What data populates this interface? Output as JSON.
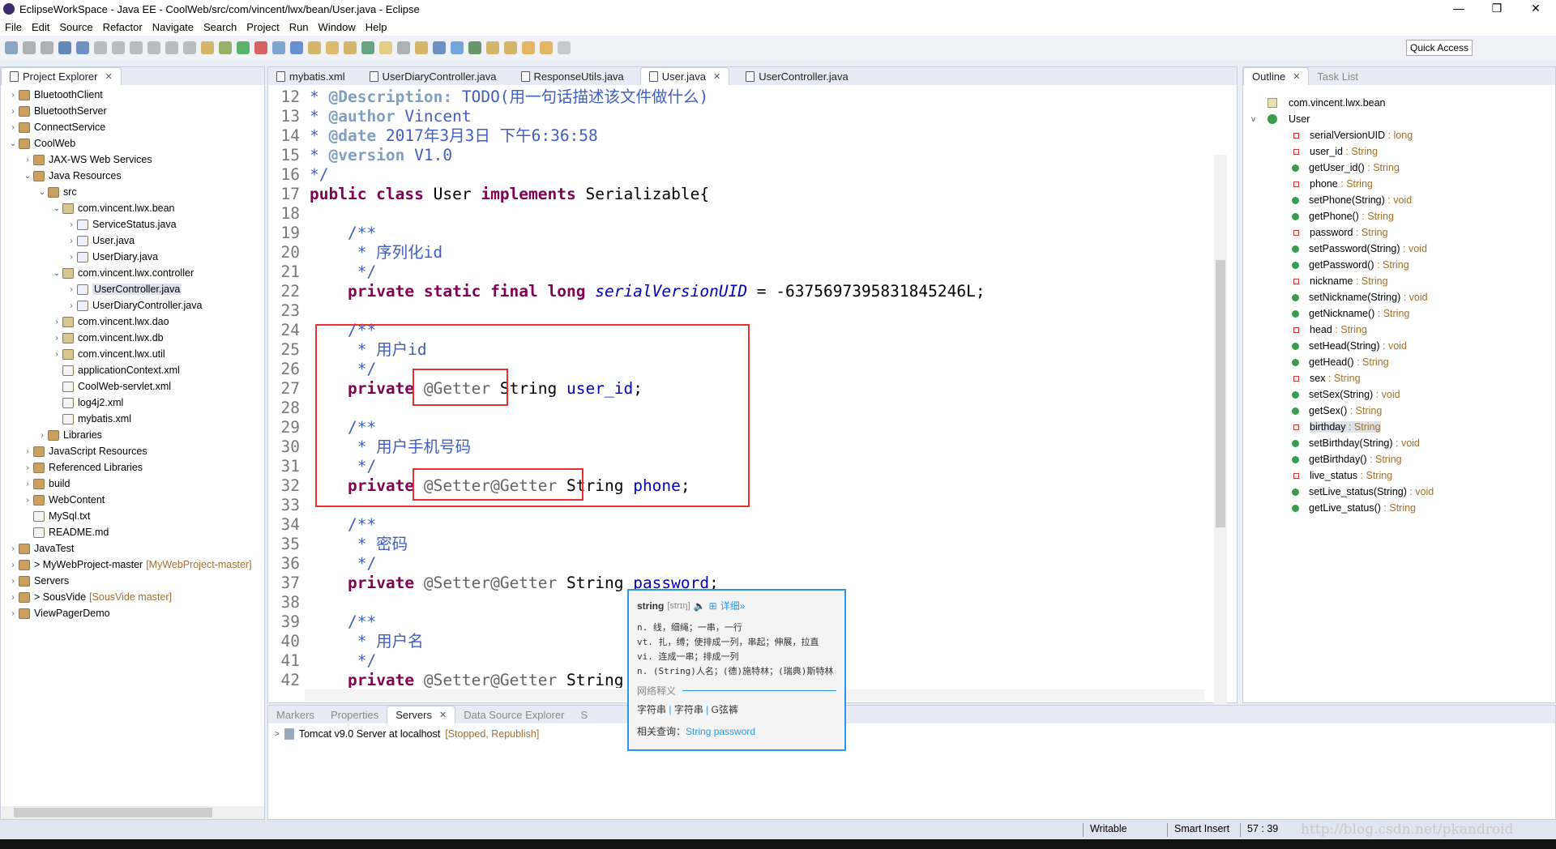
{
  "window": {
    "title": "EclipseWorkSpace - Java EE - CoolWeb/src/com/vincent/lwx/bean/User.java - Eclipse"
  },
  "menu": [
    "File",
    "Edit",
    "Source",
    "Refactor",
    "Navigate",
    "Search",
    "Project",
    "Run",
    "Window",
    "Help"
  ],
  "toolbar": {
    "quick_access": "Quick Access"
  },
  "project_explorer": {
    "title": "Project Explorer",
    "items": [
      {
        "label": "BluetoothClient",
        "level": 0,
        "exp": ">"
      },
      {
        "label": "BluetoothServer",
        "level": 0,
        "exp": ">"
      },
      {
        "label": "ConnectService",
        "level": 0,
        "exp": ">"
      },
      {
        "label": "CoolWeb",
        "level": 0,
        "exp": "v"
      },
      {
        "label": "JAX-WS Web Services",
        "level": 1,
        "exp": ">"
      },
      {
        "label": "Java Resources",
        "level": 1,
        "exp": "v"
      },
      {
        "label": "src",
        "level": 2,
        "exp": "v"
      },
      {
        "label": "com.vincent.lwx.bean",
        "level": 3,
        "exp": "v"
      },
      {
        "label": "ServiceStatus.java",
        "level": 4,
        "exp": ">"
      },
      {
        "label": "User.java",
        "level": 4,
        "exp": ">"
      },
      {
        "label": "UserDiary.java",
        "level": 4,
        "exp": ">"
      },
      {
        "label": "com.vincent.lwx.controller",
        "level": 3,
        "exp": "v"
      },
      {
        "label": "UserController.java",
        "level": 4,
        "exp": ">",
        "selected": true
      },
      {
        "label": "UserDiaryController.java",
        "level": 4,
        "exp": ">"
      },
      {
        "label": "com.vincent.lwx.dao",
        "level": 3,
        "exp": ">"
      },
      {
        "label": "com.vincent.lwx.db",
        "level": 3,
        "exp": ">"
      },
      {
        "label": "com.vincent.lwx.util",
        "level": 3,
        "exp": ">"
      },
      {
        "label": "applicationContext.xml",
        "level": 3,
        "exp": ""
      },
      {
        "label": "CoolWeb-servlet.xml",
        "level": 3,
        "exp": ""
      },
      {
        "label": "log4j2.xml",
        "level": 3,
        "exp": ""
      },
      {
        "label": "mybatis.xml",
        "level": 3,
        "exp": ""
      },
      {
        "label": "Libraries",
        "level": 2,
        "exp": ">"
      },
      {
        "label": "JavaScript Resources",
        "level": 1,
        "exp": ">"
      },
      {
        "label": "Referenced Libraries",
        "level": 1,
        "exp": ">"
      },
      {
        "label": "build",
        "level": 1,
        "exp": ">"
      },
      {
        "label": "WebContent",
        "level": 1,
        "exp": ">"
      },
      {
        "label": "MySql.txt",
        "level": 1,
        "exp": ""
      },
      {
        "label": "README.md",
        "level": 1,
        "exp": ""
      },
      {
        "label": "JavaTest",
        "level": 0,
        "exp": ">"
      },
      {
        "label": "> MyWebProject-master",
        "level": 0,
        "exp": ">",
        "deco": "[MyWebProject-master]"
      },
      {
        "label": "Servers",
        "level": 0,
        "exp": ">"
      },
      {
        "label": "> SousVide",
        "level": 0,
        "exp": ">",
        "deco": "[SousVide master]"
      },
      {
        "label": "ViewPagerDemo",
        "level": 0,
        "exp": ">"
      }
    ]
  },
  "editor": {
    "tabs": [
      "mybatis.xml",
      "UserDiaryController.java",
      "ResponseUtils.java",
      "User.java",
      "UserController.java"
    ],
    "active_tab": "User.java",
    "lines": [
      {
        "n": "12",
        "h": "<span class='cm'>* <span class='tag'>@Description:</span> TODO(用一句话描述该文件做什么)</span>"
      },
      {
        "n": "13",
        "h": "<span class='cm'>* <span class='tag'>@author</span> Vincent</span>"
      },
      {
        "n": "14",
        "h": "<span class='cm'>* <span class='tag'>@date</span> 2017年3月3日 下午6:36:58</span>"
      },
      {
        "n": "15",
        "h": "<span class='cm'>* <span class='tag'>@version</span> V1.0</span>"
      },
      {
        "n": "16",
        "h": "<span class='cm'>*/</span>"
      },
      {
        "n": "17",
        "h": "<span class='kw'>public class</span> User <span class='kw'>implements</span> Serializable{"
      },
      {
        "n": "18",
        "h": ""
      },
      {
        "n": "19",
        "h": "    <span class='cm'>/**</span>"
      },
      {
        "n": "20",
        "h": "     <span class='cm'>* 序列化id</span>"
      },
      {
        "n": "21",
        "h": "     <span class='cm'>*/</span>"
      },
      {
        "n": "22",
        "h": "    <span class='kw'>private static final long</span> <span class='it'>serialVersionUID</span> = -6375697395831845246L;"
      },
      {
        "n": "23",
        "h": ""
      },
      {
        "n": "24",
        "h": "    <span class='cm'>/**</span>"
      },
      {
        "n": "25",
        "h": "     <span class='cm'>* 用户id</span>"
      },
      {
        "n": "26",
        "h": "     <span class='cm'>*/</span>"
      },
      {
        "n": "27",
        "h": "    <span class='kw'>private</span> <span class='an'>@Getter</span> String <span class='fd'>user_id</span>;"
      },
      {
        "n": "28",
        "h": ""
      },
      {
        "n": "29",
        "h": "    <span class='cm'>/**</span>"
      },
      {
        "n": "30",
        "h": "     <span class='cm'>* 用户手机号码</span>"
      },
      {
        "n": "31",
        "h": "     <span class='cm'>*/</span>"
      },
      {
        "n": "32",
        "h": "    <span class='kw'>private</span> <span class='an'>@Setter@Getter</span> String <span class='fd'>phone</span>;"
      },
      {
        "n": "33",
        "h": ""
      },
      {
        "n": "34",
        "h": "    <span class='cm'>/**</span>"
      },
      {
        "n": "35",
        "h": "     <span class='cm'>* 密码</span>"
      },
      {
        "n": "36",
        "h": "     <span class='cm'>*/</span>"
      },
      {
        "n": "37",
        "h": "    <span class='kw'>private</span> <span class='an'>@Setter@Getter</span> String <span class='fd'>password</span>;"
      },
      {
        "n": "38",
        "h": ""
      },
      {
        "n": "39",
        "h": "    <span class='cm'>/**</span>"
      },
      {
        "n": "40",
        "h": "     <span class='cm'>* 用户名</span>"
      },
      {
        "n": "41",
        "h": "     <span class='cm'>*/</span>"
      },
      {
        "n": "42",
        "h": "    <span class='kw'>private</span> <span class='an'>@Setter@Getter</span> String"
      }
    ]
  },
  "outline": {
    "tabs": [
      "Outline",
      "Task List"
    ],
    "package": "com.vincent.lwx.bean",
    "class": "User",
    "items": [
      {
        "name": "serialVersionUID",
        "type": "long",
        "kind": "const"
      },
      {
        "name": "user_id",
        "type": "String",
        "kind": "field"
      },
      {
        "name": "getUser_id()",
        "type": "String",
        "kind": "method"
      },
      {
        "name": "phone",
        "type": "String",
        "kind": "field"
      },
      {
        "name": "setPhone(String)",
        "type": "void",
        "kind": "method"
      },
      {
        "name": "getPhone()",
        "type": "String",
        "kind": "method"
      },
      {
        "name": "password",
        "type": "String",
        "kind": "field"
      },
      {
        "name": "setPassword(String)",
        "type": "void",
        "kind": "method"
      },
      {
        "name": "getPassword()",
        "type": "String",
        "kind": "method"
      },
      {
        "name": "nickname",
        "type": "String",
        "kind": "field"
      },
      {
        "name": "setNickname(String)",
        "type": "void",
        "kind": "method"
      },
      {
        "name": "getNickname()",
        "type": "String",
        "kind": "method"
      },
      {
        "name": "head",
        "type": "String",
        "kind": "field"
      },
      {
        "name": "setHead(String)",
        "type": "void",
        "kind": "method"
      },
      {
        "name": "getHead()",
        "type": "String",
        "kind": "method"
      },
      {
        "name": "sex",
        "type": "String",
        "kind": "field"
      },
      {
        "name": "setSex(String)",
        "type": "void",
        "kind": "method"
      },
      {
        "name": "getSex()",
        "type": "String",
        "kind": "method"
      },
      {
        "name": "birthday",
        "type": "String",
        "kind": "field",
        "selected": true
      },
      {
        "name": "setBirthday(String)",
        "type": "void",
        "kind": "method"
      },
      {
        "name": "getBirthday()",
        "type": "String",
        "kind": "method"
      },
      {
        "name": "live_status",
        "type": "String",
        "kind": "field"
      },
      {
        "name": "setLive_status(String)",
        "type": "void",
        "kind": "method"
      },
      {
        "name": "getLive_status()",
        "type": "String",
        "kind": "method"
      }
    ]
  },
  "bottom": {
    "tabs": [
      "Markers",
      "Properties",
      "Servers",
      "Data Source Explorer",
      "S"
    ],
    "active_tab": "Servers",
    "server": "Tomcat v9.0 Server at localhost",
    "server_status": "[Stopped, Republish]"
  },
  "popup": {
    "word": "string",
    "phonetic": "[strɪŋ]",
    "detail": "详细»",
    "defs": [
      "n. 线，细绳；一串，一行",
      "vt. 扎，缚；使排成一列，串起；伸展，拉直",
      "vi. 连成一串；排成一列",
      "n. (String)人名；(德)施特林；(瑞典)斯特林"
    ],
    "web_label": "网络释义",
    "web": [
      "字符串",
      "字符串",
      "G弦裤"
    ],
    "related_label": "相关查询：",
    "related": "String password"
  },
  "status": {
    "writable": "Writable",
    "insert": "Smart Insert",
    "position": "57 : 39"
  },
  "watermark": "http://blog.csdn.net/pkandroid"
}
